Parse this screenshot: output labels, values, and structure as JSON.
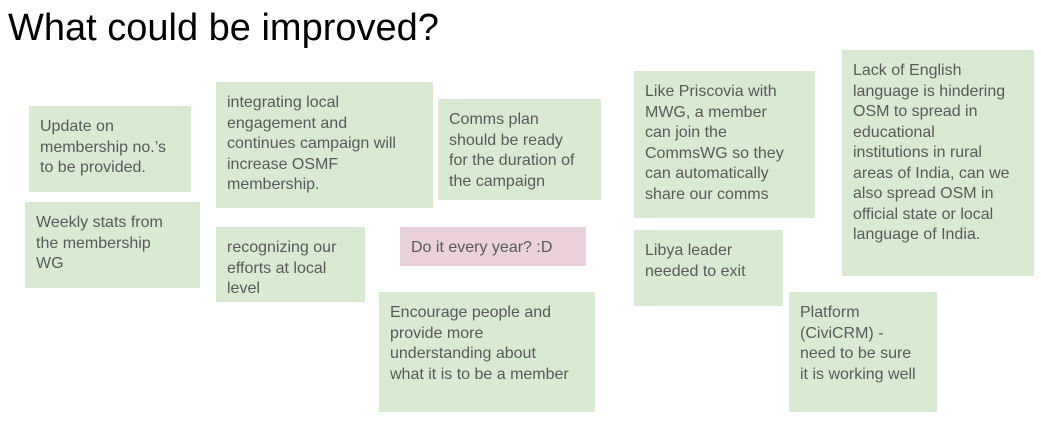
{
  "title": "What could be improved?",
  "colors": {
    "note_green": "#d9ead3",
    "note_pink": "#ead1dc",
    "note_text": "#595959"
  },
  "notes": [
    {
      "text": "Update on\nmembership no.’s\nto be provided.",
      "color": "green"
    },
    {
      "text": "Weekly stats from\nthe membership\nWG",
      "color": "green"
    },
    {
      "text": "integrating local\nengagement and\ncontinues campaign will\nincrease OSMF\nmembership.",
      "color": "green"
    },
    {
      "text": "recognizing our\nefforts at local\nlevel",
      "color": "green"
    },
    {
      "text": "Comms plan\nshould be ready\nfor the duration of\nthe campaign",
      "color": "green"
    },
    {
      "text": "Do it every year? :D",
      "color": "pink"
    },
    {
      "text": "Encourage people and\nprovide more\nunderstanding about\nwhat it is to be a member",
      "color": "green"
    },
    {
      "text": "Like Priscovia with\nMWG, a member\ncan join the\nCommsWG so they\ncan automatically\nshare our comms",
      "color": "green"
    },
    {
      "text": "Libya leader\nneeded to exit",
      "color": "green"
    },
    {
      "text": "Lack of English\nlanguage is hindering\nOSM to spread in\neducational\ninstitutions in rural\nareas of India, can we\nalso spread OSM in\nofficial state or local\nlanguage of India.",
      "color": "green"
    },
    {
      "text": "Platform\n(CiviCRM) -\nneed to be sure\nit is working well",
      "color": "green"
    }
  ]
}
